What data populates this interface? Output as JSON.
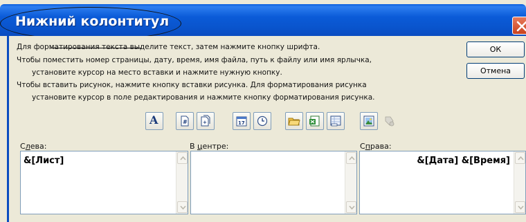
{
  "dialog": {
    "title": "Нижний колонтитул",
    "close_label": "X"
  },
  "instructions": {
    "line1": "Для форматирования текста выделите текст, затем  нажмите кнопку шрифта.",
    "line2": "Чтобы поместить номер страницы, дату, время, имя файла, путь к файлу или имя ярлычка,",
    "line3": "установите курсор на место вставки и нажмите нужную кнопку.",
    "line4": "Чтобы вставить рисунок, нажмите кнопку вставки рисунка.  Для форматирования рисунка",
    "line5": "установите курсор в поле редактирования и нажмите кнопку форматирования рисунка."
  },
  "buttons": {
    "ok": "ОК",
    "cancel": "Отмена"
  },
  "toolbar": {
    "font_glyph": "A",
    "items": [
      "font-icon",
      "page-number-icon",
      "page-count-icon",
      "date-icon",
      "time-icon",
      "file-path-icon",
      "file-name-icon",
      "sheet-name-icon",
      "insert-picture-icon",
      "format-picture-icon"
    ]
  },
  "sections": {
    "left": {
      "label_prefix": "С",
      "label_underlined": "л",
      "label_suffix": "ева:",
      "value": "&[Лист]"
    },
    "center": {
      "label_prefix": "В ",
      "label_underlined": "ц",
      "label_suffix": "ентре:",
      "value": ""
    },
    "right": {
      "label_prefix": "С",
      "label_underlined": "п",
      "label_suffix": "рава:",
      "value": "&[Дата] &[Время]"
    }
  },
  "colors": {
    "titlebar": "#0a5ddb",
    "dialog_bg": "#ece9d8",
    "close_button": "#c9431e"
  }
}
